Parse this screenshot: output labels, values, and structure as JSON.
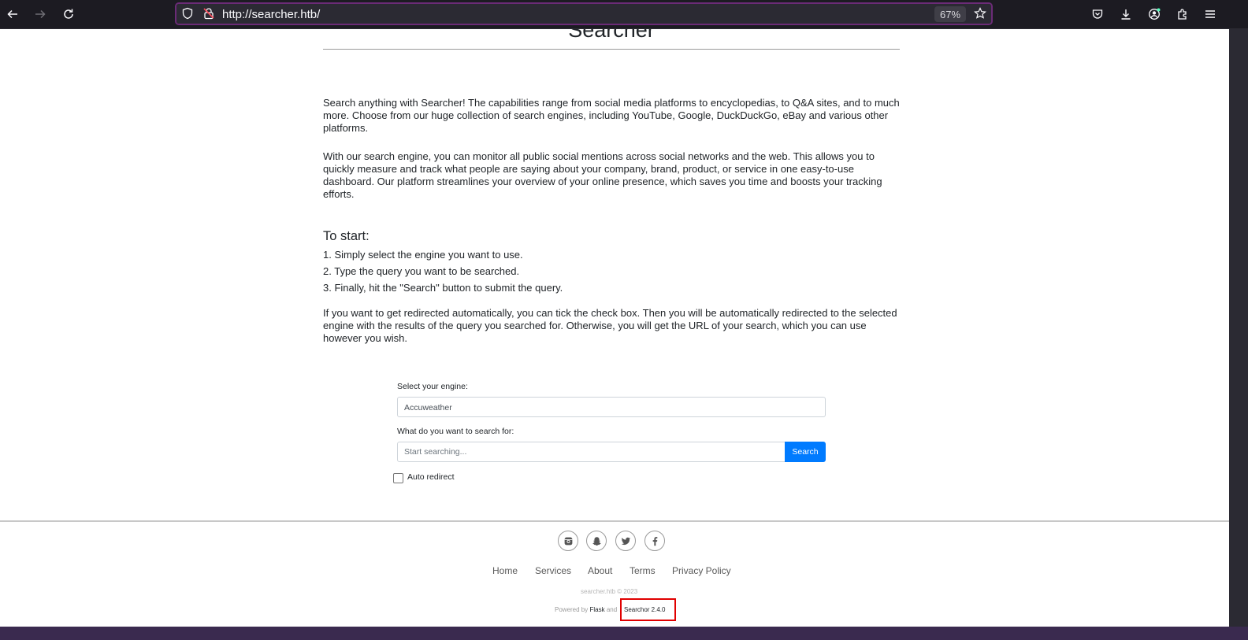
{
  "browser": {
    "url": "http://searcher.htb/",
    "zoom": "67%"
  },
  "page": {
    "site_title": "Searcher",
    "intro_1": "Search anything with Searcher! The capabilities range from social media platforms to encyclopedias, to Q&A sites, and to much more. Choose from our huge collection of search engines, including YouTube, Google, DuckDuckGo, eBay and various other platforms.",
    "intro_2": "With our search engine, you can monitor all public social mentions across social networks and the web. This allows you to quickly measure and track what people are saying about your company, brand, product, or service in one easy-to-use dashboard. Our platform streamlines your overview of your online presence, which saves you time and boosts your tracking efforts.",
    "start_heading": "To start:",
    "steps": [
      "1. Simply select the engine you want to use.",
      "2. Type the query you want to be searched.",
      "3. Finally, hit the \"Search\" button to submit the query."
    ],
    "redirect_info": "If you want to get redirected automatically, you can tick the check box. Then you will be automatically redirected to the selected engine with the results of the query you searched for. Otherwise, you will get the URL of your search, which you can use however you wish."
  },
  "form": {
    "engine_label": "Select your engine:",
    "engine_value": "Accuweather",
    "query_label": "What do you want to search for:",
    "query_placeholder": "Start searching...",
    "search_button": "Search",
    "auto_redirect_label": "Auto redirect"
  },
  "footer": {
    "social_icons": [
      "instagram-icon",
      "snapchat-icon",
      "twitter-icon",
      "facebook-icon"
    ],
    "links": [
      "Home",
      "Services",
      "About",
      "Terms",
      "Privacy Policy"
    ],
    "copyright": "searcher.htb © 2023",
    "powered_prefix": "Powered by",
    "powered_flask": "Flask",
    "powered_and": "and",
    "version": "Searchor 2.4.0"
  },
  "colors": {
    "accent": "#007bff",
    "url_border": "#6b2b77",
    "highlight": "#e00000"
  }
}
